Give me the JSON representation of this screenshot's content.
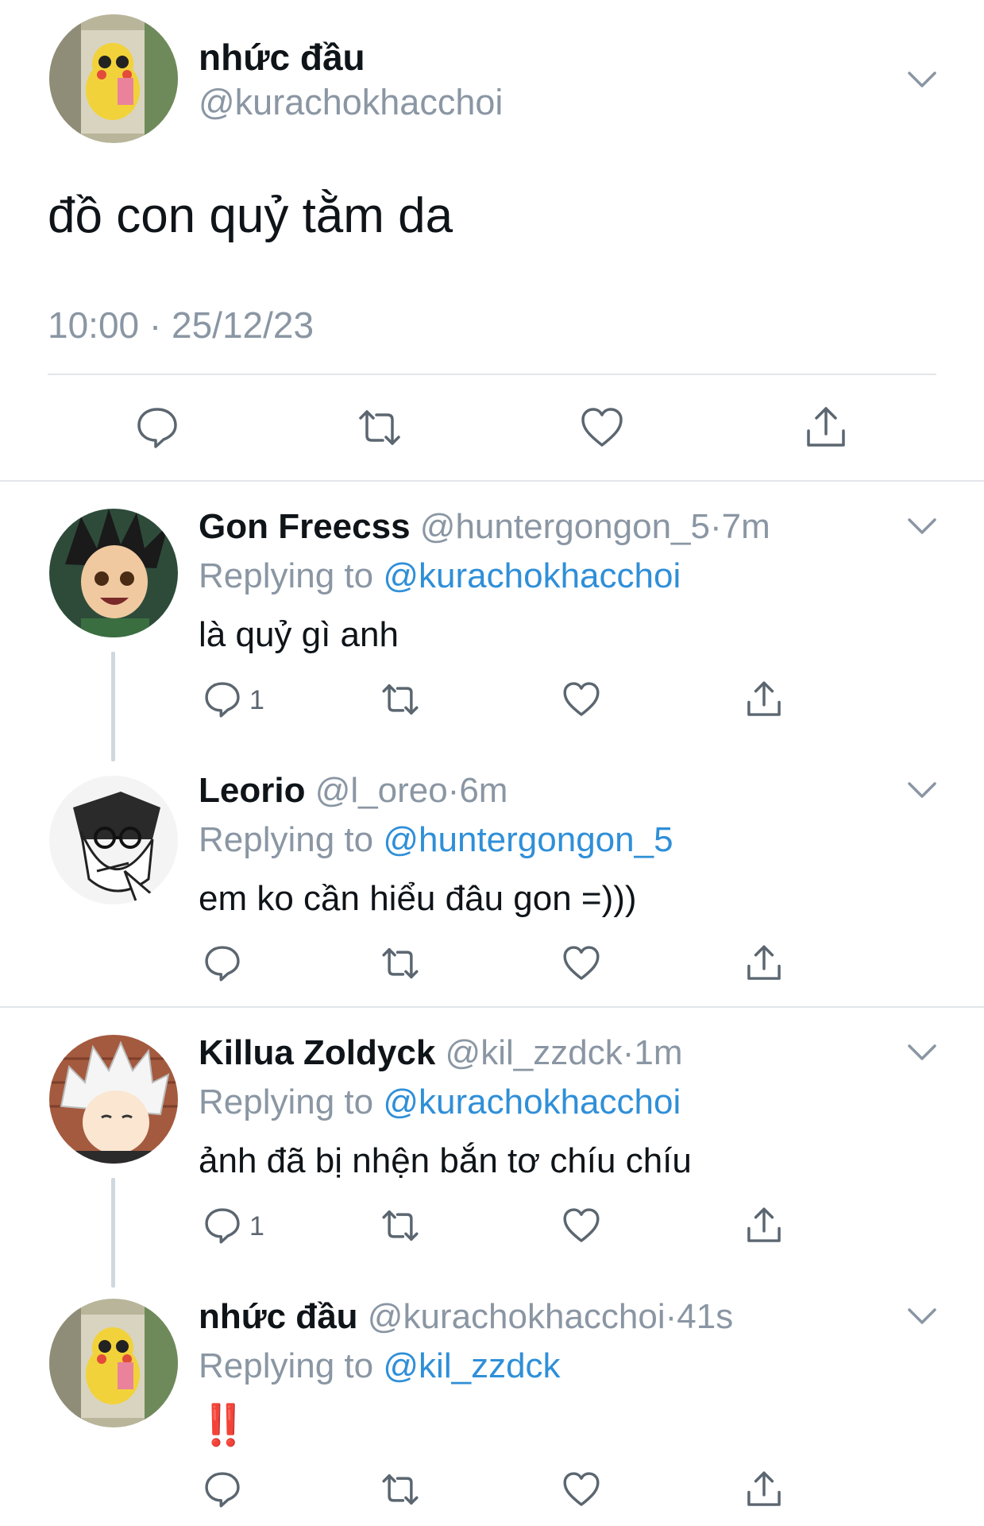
{
  "main_tweet": {
    "display_name": "nhức đầu",
    "handle": "@kurachokhacchoi",
    "text": "đồ con quỷ tằm da",
    "timestamp": "10:00 · 25/12/23"
  },
  "replies": [
    {
      "display_name": "Gon Freecss",
      "handle": "@huntergongon_5",
      "time": "·7m",
      "replying_label": "Replying to",
      "replying_to": "@kurachokhacchoi",
      "text": "là quỷ gì anh",
      "reply_count": "1"
    },
    {
      "display_name": "Leorio",
      "handle": "@l_oreo",
      "time": "·6m",
      "replying_label": "Replying to",
      "replying_to": "@huntergongon_5",
      "text": "em ko cần hiểu đâu gon =)))",
      "reply_count": ""
    },
    {
      "display_name": "Killua Zoldyck",
      "handle": "@kil_zzdck",
      "time": "·1m",
      "replying_label": "Replying to",
      "replying_to": "@kurachokhacchoi",
      "text": "ảnh đã bị nhện bắn tơ chíu chíu",
      "reply_count": "1"
    },
    {
      "display_name": "nhức đầu",
      "handle": "@kurachokhacchoi",
      "time": "·41s",
      "replying_label": "Replying to",
      "replying_to": "@kil_zzdck",
      "text": "‼️",
      "reply_count": ""
    }
  ],
  "icons": {
    "reply": "reply-icon",
    "retweet": "retweet-icon",
    "like": "like-icon",
    "share": "share-icon",
    "more": "chevron-down-icon"
  },
  "colors": {
    "link": "#2f8fd8",
    "muted": "#8a96a3",
    "icon": "#5b6670",
    "divider": "#e2e6ea",
    "exclaim": "#e0245e"
  }
}
